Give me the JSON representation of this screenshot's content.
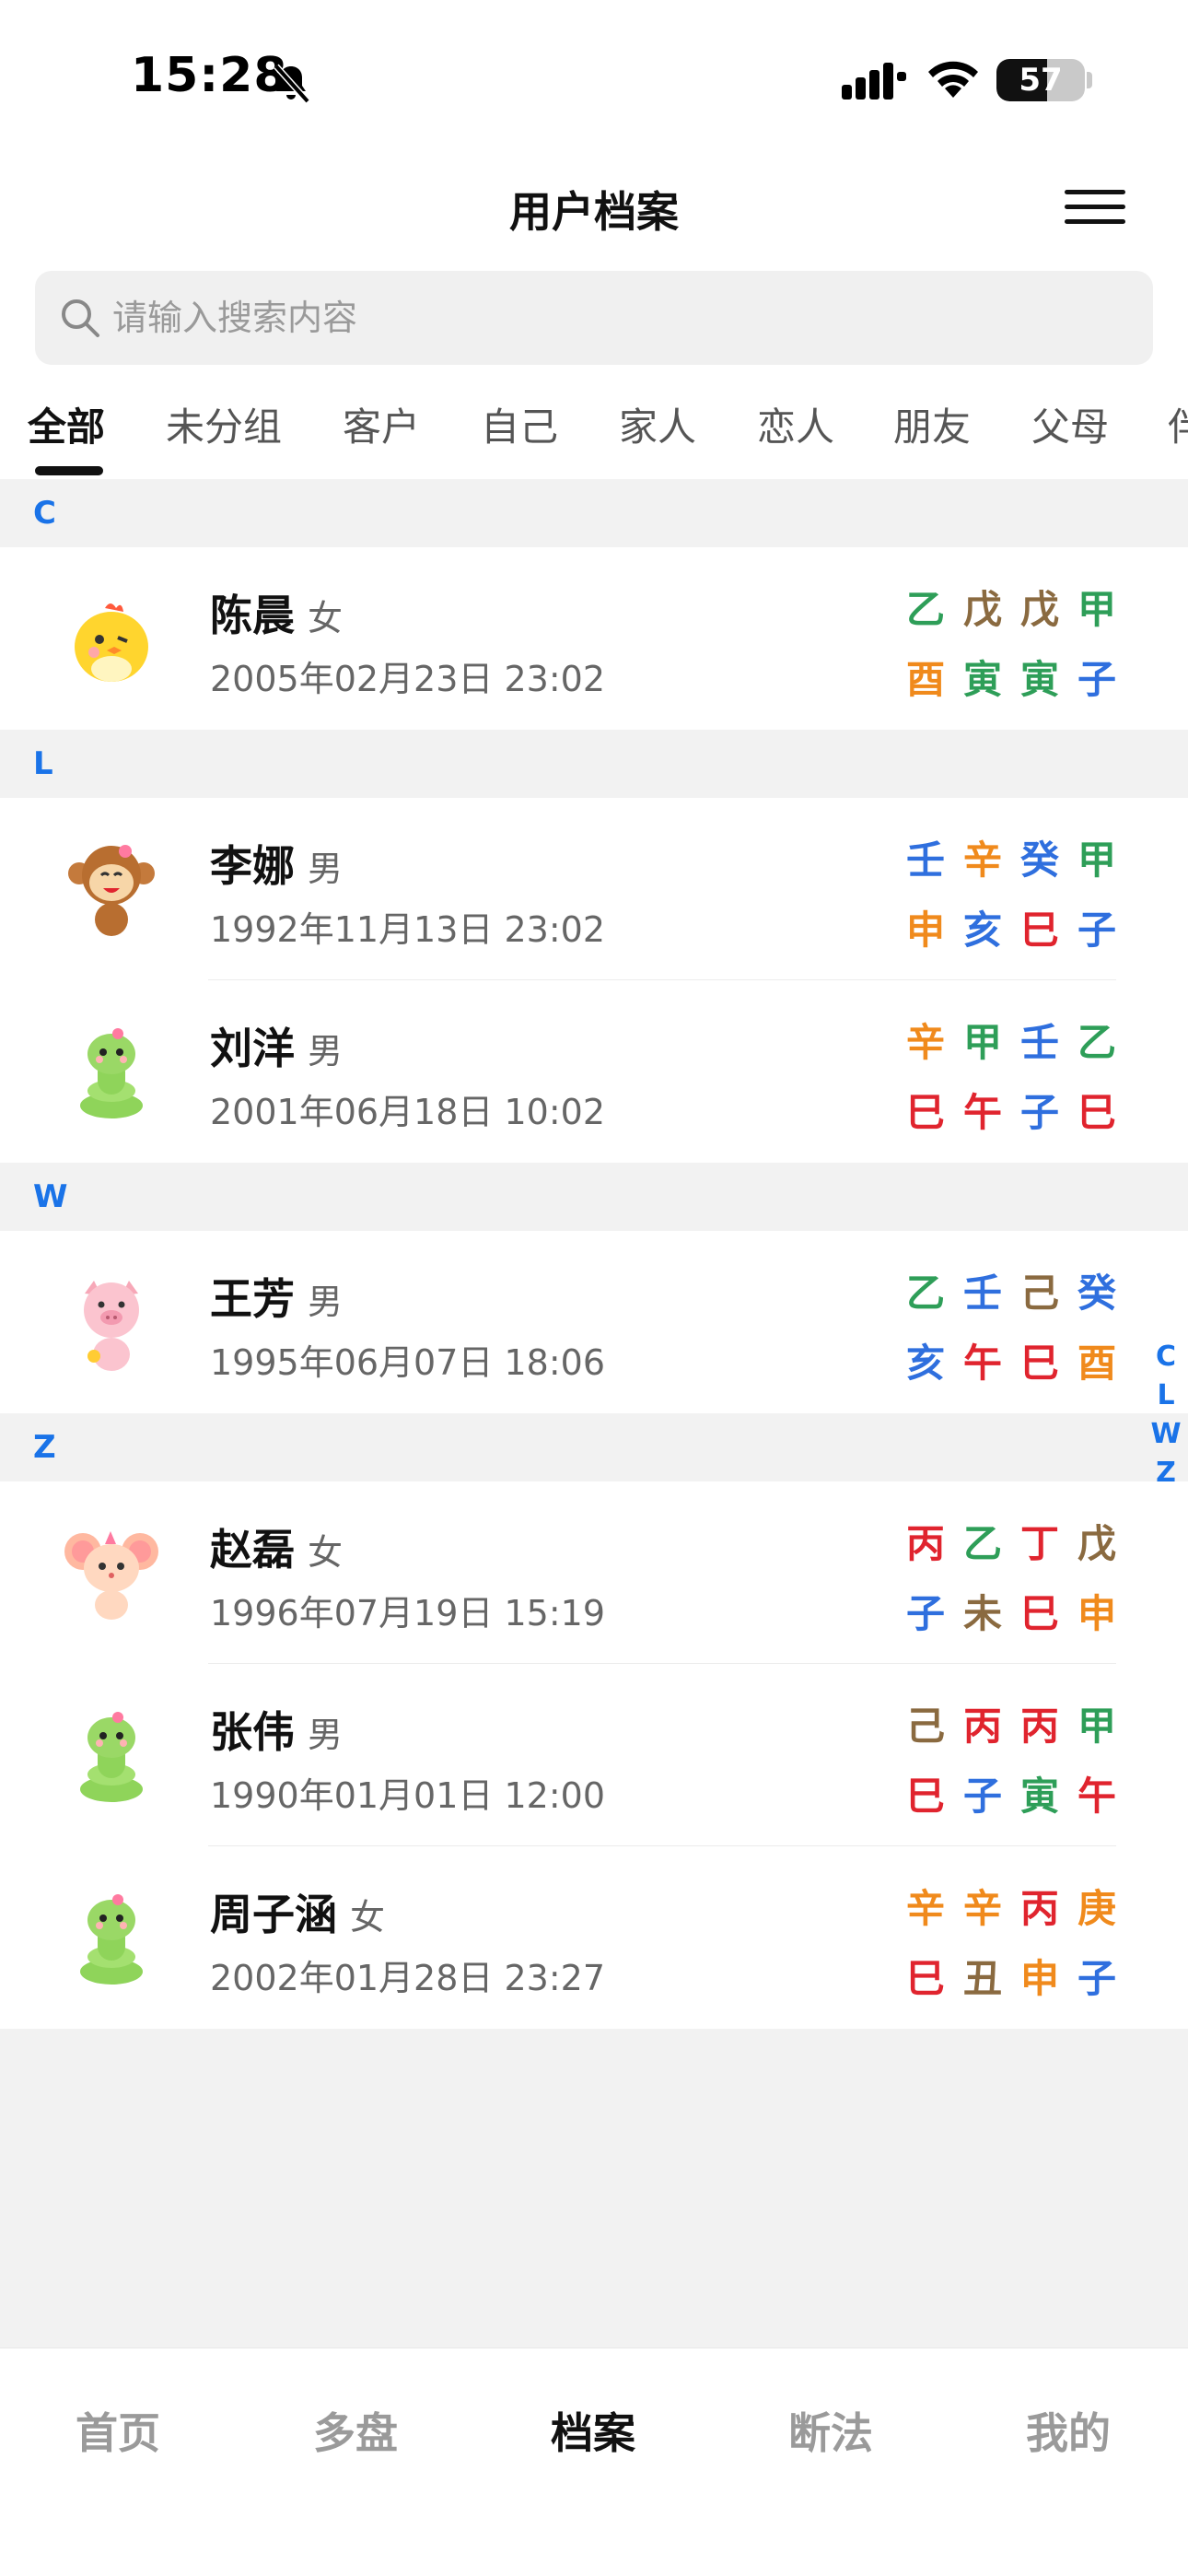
{
  "status_bar": {
    "time": "15:28",
    "battery": "57",
    "battery_level": 0.57
  },
  "header": {
    "title": "用户档案"
  },
  "search": {
    "placeholder": "请输入搜索内容",
    "value": ""
  },
  "tabs": [
    "全部",
    "未分组",
    "客户",
    "自己",
    "家人",
    "恋人",
    "朋友",
    "父母",
    "伴"
  ],
  "active_tab": "全部",
  "groups": [
    {
      "letter": "C",
      "users": [
        {
          "name": "陈晨",
          "gender": "女",
          "birth": "2005年02月23日 23:02",
          "avatar": "chick-avatar-icon",
          "stems": [
            "乙",
            "戊",
            "戊",
            "甲"
          ],
          "stem_colors": [
            "#2e9e58",
            "#8a6a40",
            "#8a6a40",
            "#2e9e58"
          ],
          "branches": [
            "酉",
            "寅",
            "寅",
            "子"
          ],
          "branch_colors": [
            "#f08a1c",
            "#2e9e58",
            "#2e9e58",
            "#2f6fde"
          ]
        }
      ]
    },
    {
      "letter": "L",
      "users": [
        {
          "name": "李娜",
          "gender": "男",
          "birth": "1992年11月13日 23:02",
          "avatar": "monkey-avatar-icon",
          "stems": [
            "壬",
            "辛",
            "癸",
            "甲"
          ],
          "stem_colors": [
            "#2f6fde",
            "#f08a1c",
            "#2f6fde",
            "#2e9e58"
          ],
          "branches": [
            "申",
            "亥",
            "巳",
            "子"
          ],
          "branch_colors": [
            "#f08a1c",
            "#2f6fde",
            "#e0242e",
            "#2f6fde"
          ]
        },
        {
          "name": "刘洋",
          "gender": "男",
          "birth": "2001年06月18日 10:02",
          "avatar": "snake-avatar-icon",
          "stems": [
            "辛",
            "甲",
            "壬",
            "乙"
          ],
          "stem_colors": [
            "#f08a1c",
            "#2e9e58",
            "#2f6fde",
            "#2e9e58"
          ],
          "branches": [
            "巳",
            "午",
            "子",
            "巳"
          ],
          "branch_colors": [
            "#e0242e",
            "#e0242e",
            "#2f6fde",
            "#e0242e"
          ]
        }
      ]
    },
    {
      "letter": "W",
      "users": [
        {
          "name": "王芳",
          "gender": "男",
          "birth": "1995年06月07日 18:06",
          "avatar": "pig-avatar-icon",
          "stems": [
            "乙",
            "壬",
            "己",
            "癸"
          ],
          "stem_colors": [
            "#2e9e58",
            "#2f6fde",
            "#8a6a40",
            "#2f6fde"
          ],
          "branches": [
            "亥",
            "午",
            "巳",
            "酉"
          ],
          "branch_colors": [
            "#2f6fde",
            "#e0242e",
            "#e0242e",
            "#f08a1c"
          ]
        }
      ]
    },
    {
      "letter": "Z",
      "users": [
        {
          "name": "赵磊",
          "gender": "女",
          "birth": "1996年07月19日 15:19",
          "avatar": "mouse-avatar-icon",
          "stems": [
            "丙",
            "乙",
            "丁",
            "戊"
          ],
          "stem_colors": [
            "#e0242e",
            "#2e9e58",
            "#e0242e",
            "#8a6a40"
          ],
          "branches": [
            "子",
            "未",
            "巳",
            "申"
          ],
          "branch_colors": [
            "#2f6fde",
            "#8a6a40",
            "#e0242e",
            "#f08a1c"
          ]
        },
        {
          "name": "张伟",
          "gender": "男",
          "birth": "1990年01月01日 12:00",
          "avatar": "snake-avatar-icon",
          "stems": [
            "己",
            "丙",
            "丙",
            "甲"
          ],
          "stem_colors": [
            "#8a6a40",
            "#e0242e",
            "#e0242e",
            "#2e9e58"
          ],
          "branches": [
            "巳",
            "子",
            "寅",
            "午"
          ],
          "branch_colors": [
            "#e0242e",
            "#2f6fde",
            "#2e9e58",
            "#e0242e"
          ]
        },
        {
          "name": "周子涵",
          "gender": "女",
          "birth": "2002年01月28日 23:27",
          "avatar": "snake-avatar-icon",
          "stems": [
            "辛",
            "辛",
            "丙",
            "庚"
          ],
          "stem_colors": [
            "#f08a1c",
            "#f08a1c",
            "#e0242e",
            "#f08a1c"
          ],
          "branches": [
            "巳",
            "丑",
            "申",
            "子"
          ],
          "branch_colors": [
            "#e0242e",
            "#8a6a40",
            "#f08a1c",
            "#2f6fde"
          ]
        }
      ]
    }
  ],
  "index_letters": [
    "C",
    "L",
    "W",
    "Z"
  ],
  "bottom_nav": [
    "首页",
    "多盘",
    "档案",
    "断法",
    "我的"
  ],
  "active_nav": "档案",
  "colors": {
    "accent_blue": "#1a73e8",
    "wood": "#2e9e58",
    "fire": "#e0242e",
    "earth": "#8a6a40",
    "metal": "#f08a1c",
    "water": "#2f6fde"
  }
}
